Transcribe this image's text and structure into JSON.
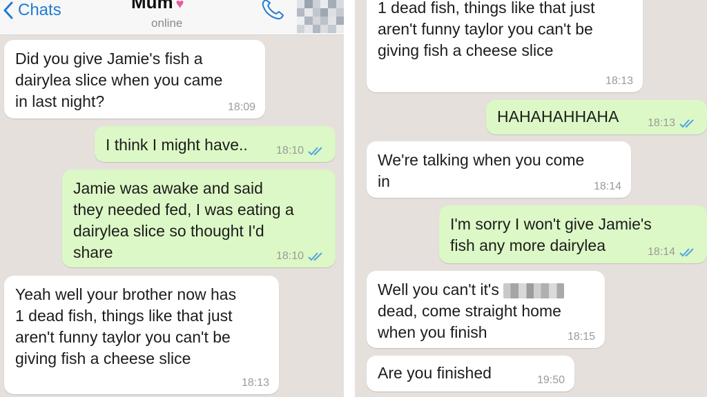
{
  "header": {
    "back_label": "Chats",
    "contact_name": "Mum",
    "heart": "♥",
    "status": "online"
  },
  "left_messages": [
    {
      "text": "Did you give Jamie's fish a\ndairylea slice when you came\nin last night?",
      "time": "18:09",
      "direction": "incoming"
    },
    {
      "text": "I think I might have..",
      "time": "18:10",
      "direction": "outgoing",
      "read": true
    },
    {
      "text": "Jamie was awake and said\nthey needed fed, I was eating a\ndairylea slice so thought I'd\nshare",
      "time": "18:10",
      "direction": "outgoing",
      "read": true
    },
    {
      "text": "Yeah well your brother now has\n1 dead fish, things like that just\naren't funny taylor you can't be\ngiving fish a cheese slice",
      "time": "18:13",
      "direction": "incoming"
    }
  ],
  "right_messages": [
    {
      "text": "1 dead fish, things like that just\naren't funny taylor you can't be\ngiving fish a cheese slice",
      "time": "18:13",
      "direction": "incoming"
    },
    {
      "text": "HAHAHAHHAHA",
      "time": "18:13",
      "direction": "outgoing",
      "read": true
    },
    {
      "text": "We're talking when you come\nin",
      "time": "18:14",
      "direction": "incoming"
    },
    {
      "text": "I'm sorry I won't give Jamie's\nfish any more dairylea",
      "time": "18:14",
      "direction": "outgoing",
      "read": true
    },
    {
      "text_before": "Well you can't it's",
      "text_after": "dead, come straight home\nwhen you finish",
      "time": "18:15",
      "direction": "incoming",
      "censored": true
    },
    {
      "text": "Are you finished",
      "time": "19:50",
      "direction": "incoming"
    }
  ],
  "colors": {
    "chat_background": "#e6e0dc",
    "incoming_bubble": "#ffffff",
    "outgoing_bubble": "#dcf8c6",
    "accent_blue": "#1e7bd6",
    "read_tick": "#4fa3e0",
    "heart": "#e85a9a"
  },
  "icons": [
    "chevron-left-icon",
    "phone-icon",
    "heart-icon",
    "read-receipt-icon"
  ]
}
